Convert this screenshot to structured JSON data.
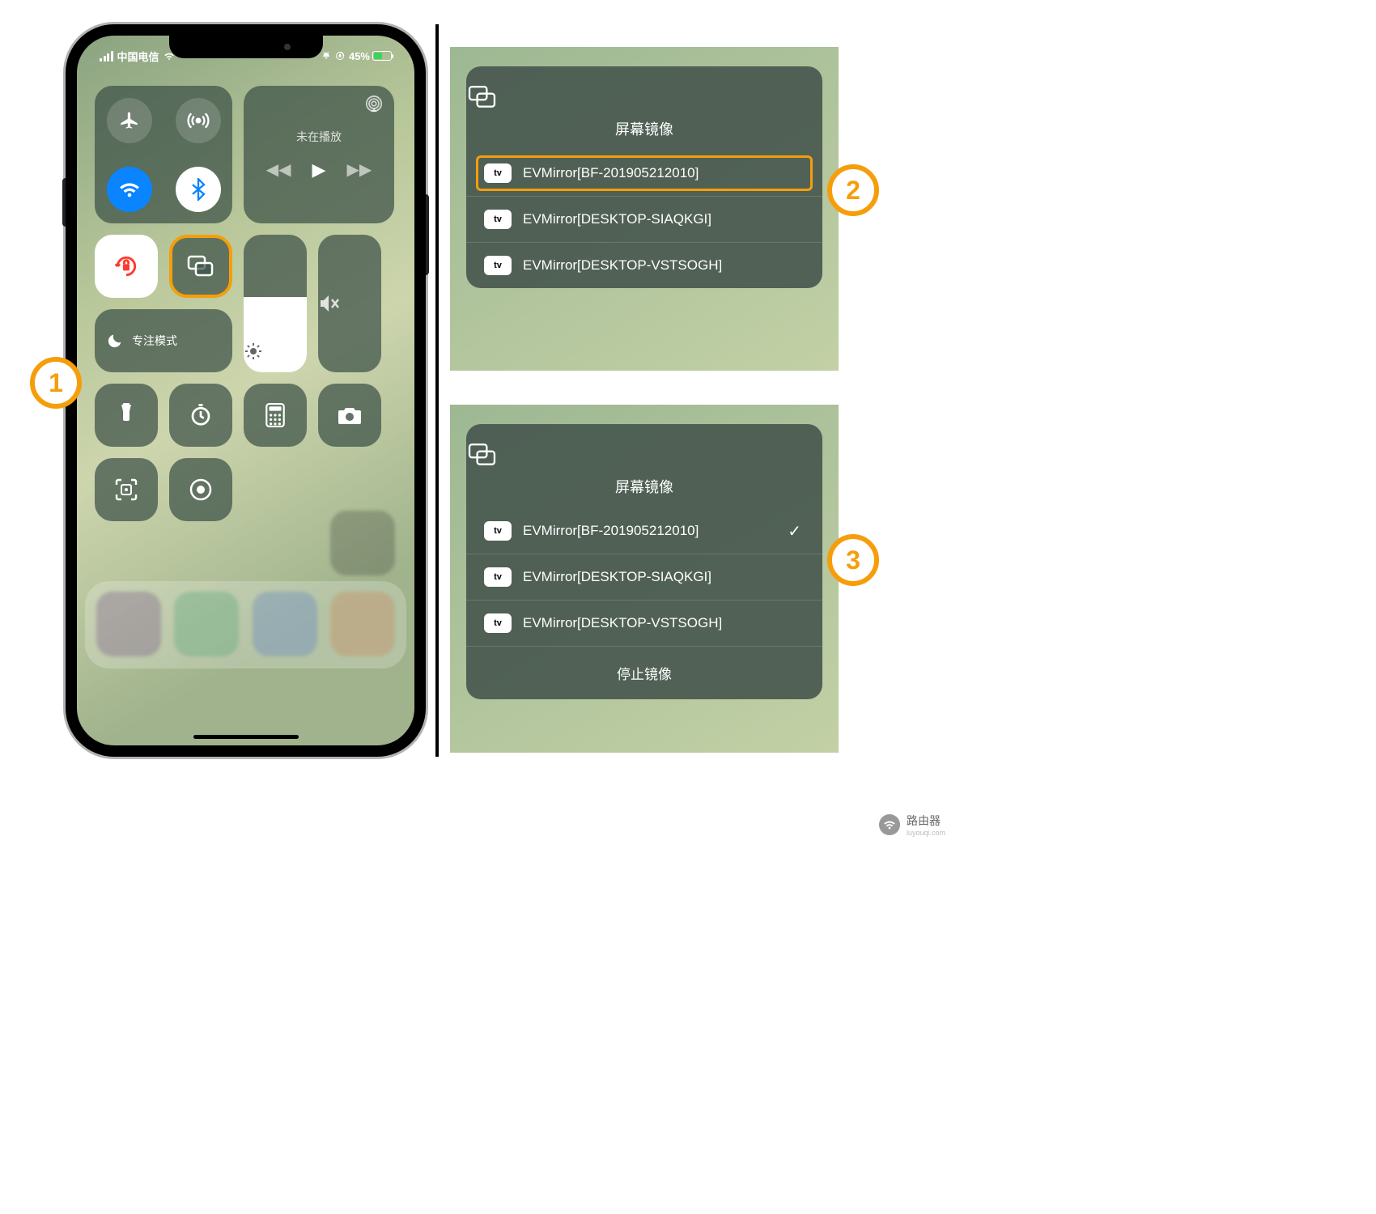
{
  "status": {
    "carrier": "中国电信",
    "battery_pct": "45%"
  },
  "cc": {
    "now_playing": "未在播放",
    "focus_label": "专注模式"
  },
  "panels": {
    "title": "屏幕镜像",
    "devices": [
      "EVMirror[BF-201905212010]",
      "EVMirror[DESKTOP-SIAQKGI]",
      "EVMirror[DESKTOP-VSTSOGH]"
    ],
    "stop": "停止镜像",
    "badge": "tv"
  },
  "callouts": {
    "c1": "1",
    "c2": "2",
    "c3": "3"
  },
  "watermark": {
    "name": "路由器",
    "sub": "luyouqi.com"
  }
}
